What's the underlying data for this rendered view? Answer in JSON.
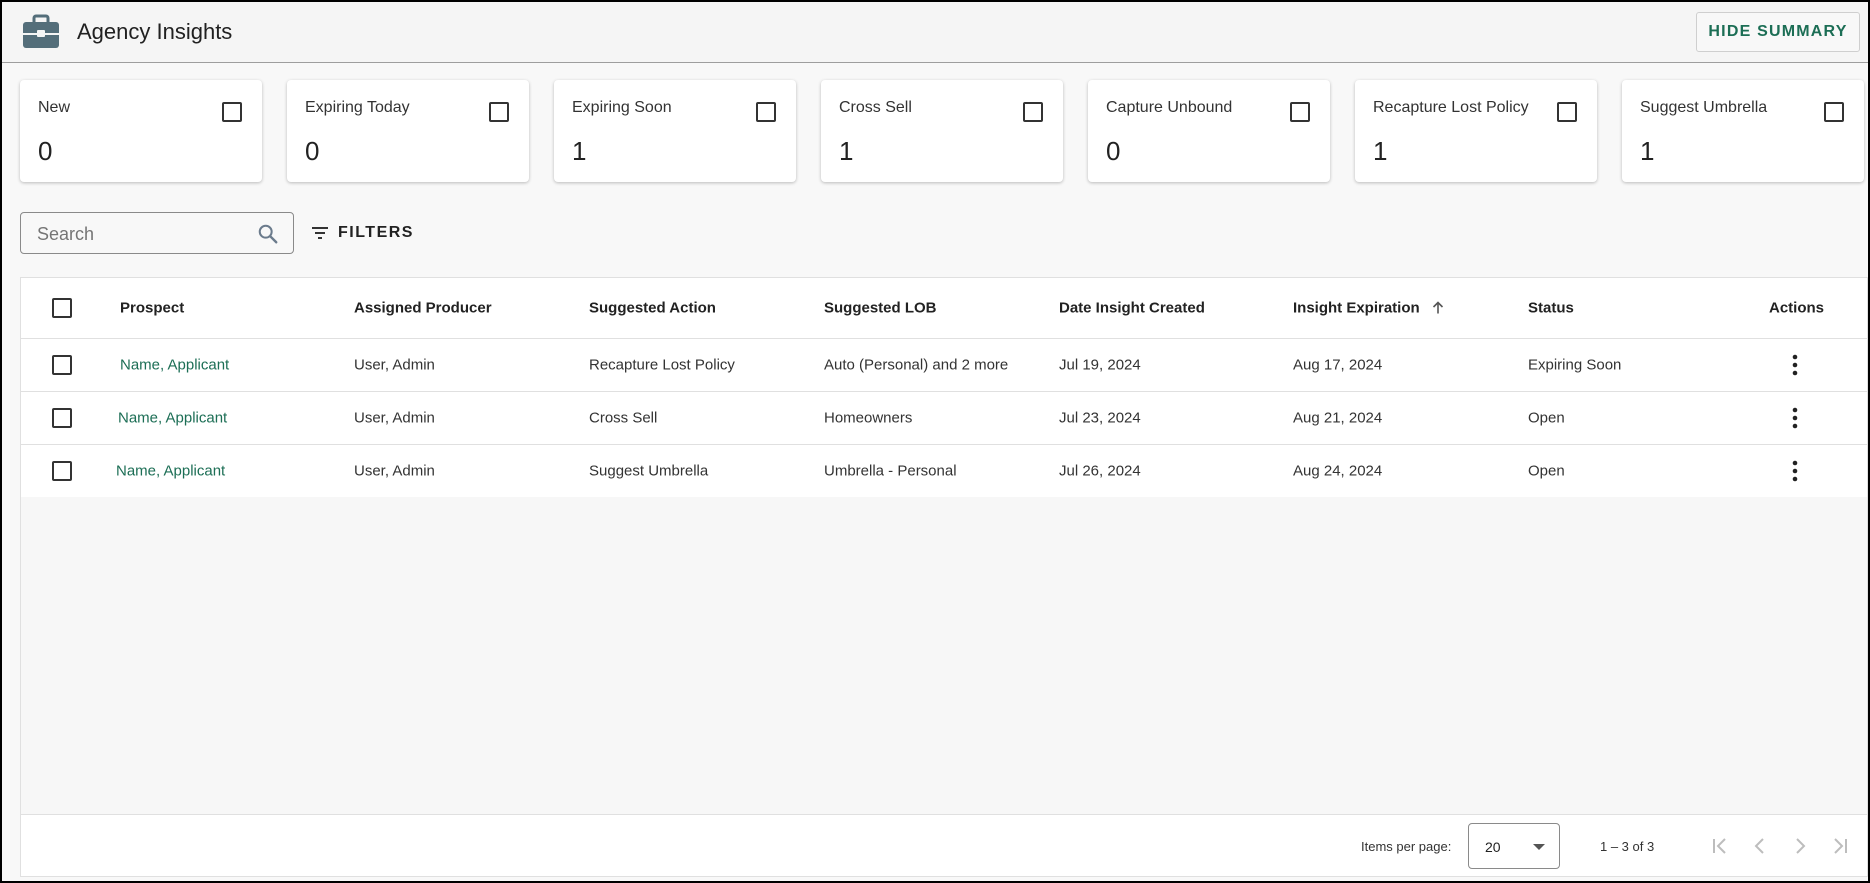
{
  "header": {
    "title": "Agency Insights",
    "hide_summary_label": "HIDE SUMMARY",
    "app_icon": "briefcase-icon"
  },
  "summary_cards": [
    {
      "label": "New",
      "value": "0"
    },
    {
      "label": "Expiring Today",
      "value": "0"
    },
    {
      "label": "Expiring Soon",
      "value": "1"
    },
    {
      "label": "Cross Sell",
      "value": "1"
    },
    {
      "label": "Capture Unbound",
      "value": "0"
    },
    {
      "label": "Recapture Lost Policy",
      "value": "1"
    },
    {
      "label": "Suggest Umbrella",
      "value": "1"
    }
  ],
  "search": {
    "placeholder": "Search",
    "value": ""
  },
  "filters": {
    "label": "FILTERS"
  },
  "table": {
    "columns": [
      "Prospect",
      "Assigned Producer",
      "Suggested Action",
      "Suggested LOB",
      "Date Insight Created",
      "Insight Expiration",
      "Status",
      "Actions"
    ],
    "sort": {
      "column": "Insight Expiration",
      "direction": "ascending"
    },
    "rows": [
      {
        "prospect": "Name, Applicant",
        "producer": "User, Admin",
        "action": "Recapture Lost Policy",
        "lob": "Auto (Personal) and 2 more",
        "created": "Jul 19, 2024",
        "expiration": "Aug 17, 2024",
        "status": "Expiring Soon"
      },
      {
        "prospect": "Name, Applicant",
        "producer": "User, Admin",
        "action": "Cross Sell",
        "lob": "Homeowners",
        "created": "Jul 23, 2024",
        "expiration": "Aug 21, 2024",
        "status": "Open"
      },
      {
        "prospect": "Name, Applicant",
        "producer": "User, Admin",
        "action": "Suggest Umbrella",
        "lob": "Umbrella - Personal",
        "created": "Jul 26, 2024",
        "expiration": "Aug 24, 2024",
        "status": "Open"
      }
    ]
  },
  "paginator": {
    "items_per_page_label": "Items per page:",
    "items_per_page": "20",
    "range": "1 – 3 of 3"
  },
  "colors": {
    "accent": "#1c6e55",
    "icon": "#546e7a"
  }
}
